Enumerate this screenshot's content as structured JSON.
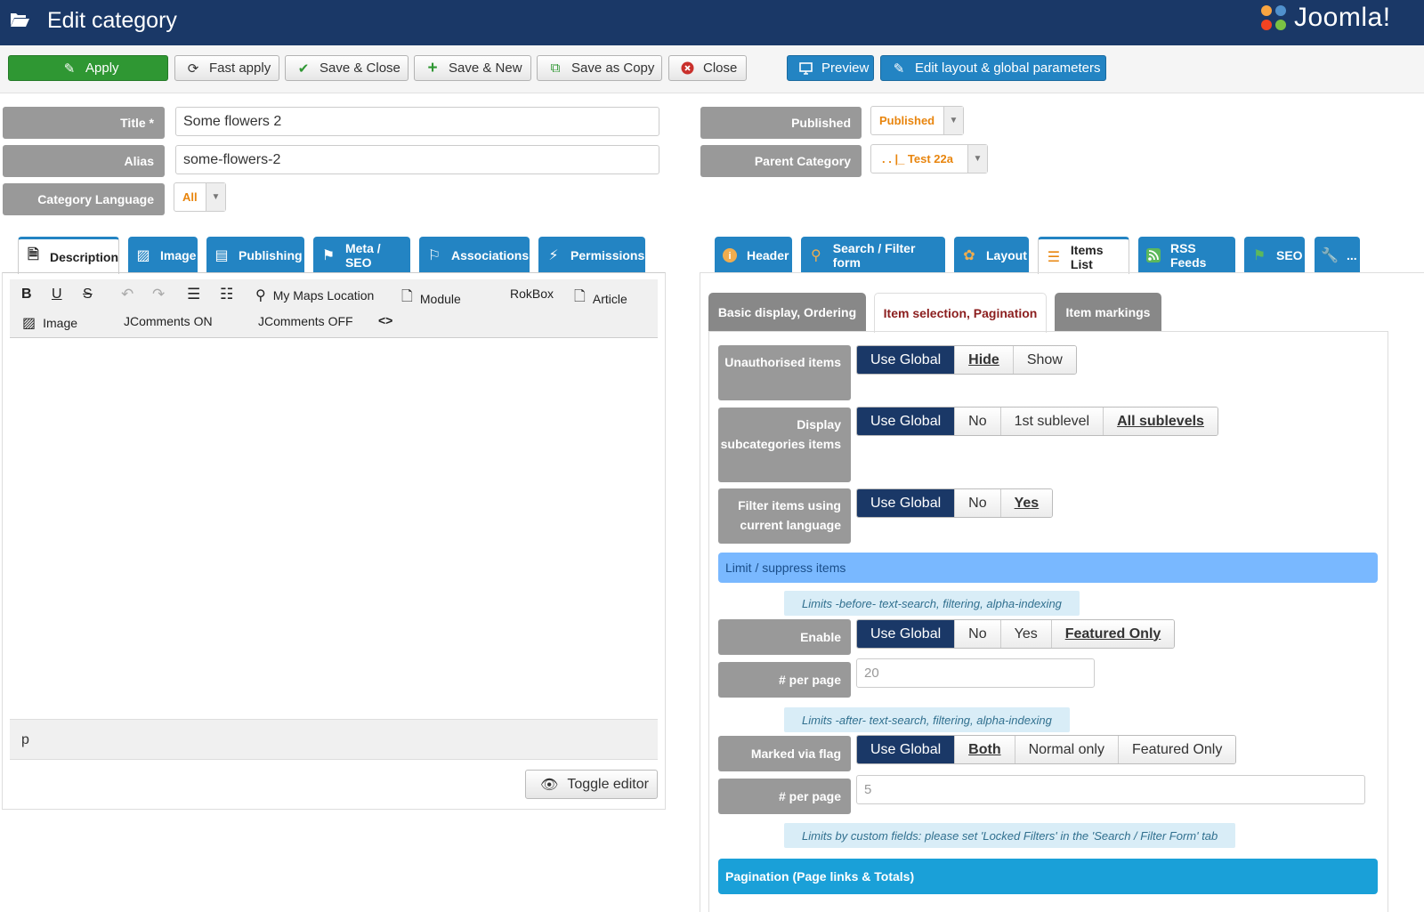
{
  "header": {
    "title": "Edit category",
    "logo_text": "Joomla!"
  },
  "toolbar": {
    "apply": "Apply",
    "fast_apply": "Fast apply",
    "save_close": "Save & Close",
    "save_new": "Save & New",
    "save_copy": "Save as Copy",
    "close": "Close",
    "preview": "Preview",
    "edit_layout": "Edit layout & global parameters"
  },
  "form": {
    "title_label": "Title *",
    "title_value": "Some flowers 2",
    "alias_label": "Alias",
    "alias_value": "some-flowers-2",
    "language_label": "Category Language",
    "language_value": "All",
    "published_label": "Published",
    "published_value": "Published",
    "parent_label": "Parent Category",
    "parent_value": ". . |_ Test 22a"
  },
  "left_tabs": [
    "Description",
    "Image",
    "Publishing",
    "Meta / SEO",
    "Associations",
    "Permissions"
  ],
  "editor": {
    "my_maps": "My Maps Location",
    "module": "Module",
    "rokbox": "RokBox",
    "article": "Article",
    "image": "Image",
    "jcomments_on": "JComments ON",
    "jcomments_off": "JComments OFF",
    "status_path": "p",
    "toggle": "Toggle editor"
  },
  "right_tabs": [
    "Header",
    "Search / Filter form",
    "Layout",
    "Items List",
    "RSS Feeds",
    "SEO",
    "..."
  ],
  "sub_tabs": [
    "Basic display, Ordering",
    "Item selection, Pagination",
    "Item markings"
  ],
  "settings": {
    "unauth_label": "Unauthorised items",
    "unauth_opts": [
      "Use Global",
      "Hide",
      "Show"
    ],
    "subcat_label": "Display subcategories items",
    "subcat_opts": [
      "Use Global",
      "No",
      "1st sublevel",
      "All sublevels"
    ],
    "lang_label": "Filter items using current language",
    "lang_opts": [
      "Use Global",
      "No",
      "Yes"
    ],
    "limit_section": "Limit / suppress items",
    "note_before": "Limits -before- text-search, filtering, alpha-indexing",
    "enable_label": "Enable",
    "enable_opts": [
      "Use Global",
      "No",
      "Yes",
      "Featured Only"
    ],
    "per_page_label": "# per page",
    "per_page_1": "20",
    "note_after": "Limits -after- text-search, filtering, alpha-indexing",
    "flag_label": "Marked via flag",
    "flag_opts": [
      "Use Global",
      "Both",
      "Normal only",
      "Featured Only"
    ],
    "per_page_2": "5",
    "note_custom": "Limits by custom fields: please set 'Locked Filters' in the 'Search / Filter Form' tab",
    "pagination_section": "Pagination (Page links & Totals)"
  },
  "colors": {
    "header_bg": "#1a3867",
    "apply_green": "#2f9733",
    "tab_blue": "#2384c3",
    "label_gray": "#999999",
    "active_toggle": "#1a3867"
  }
}
